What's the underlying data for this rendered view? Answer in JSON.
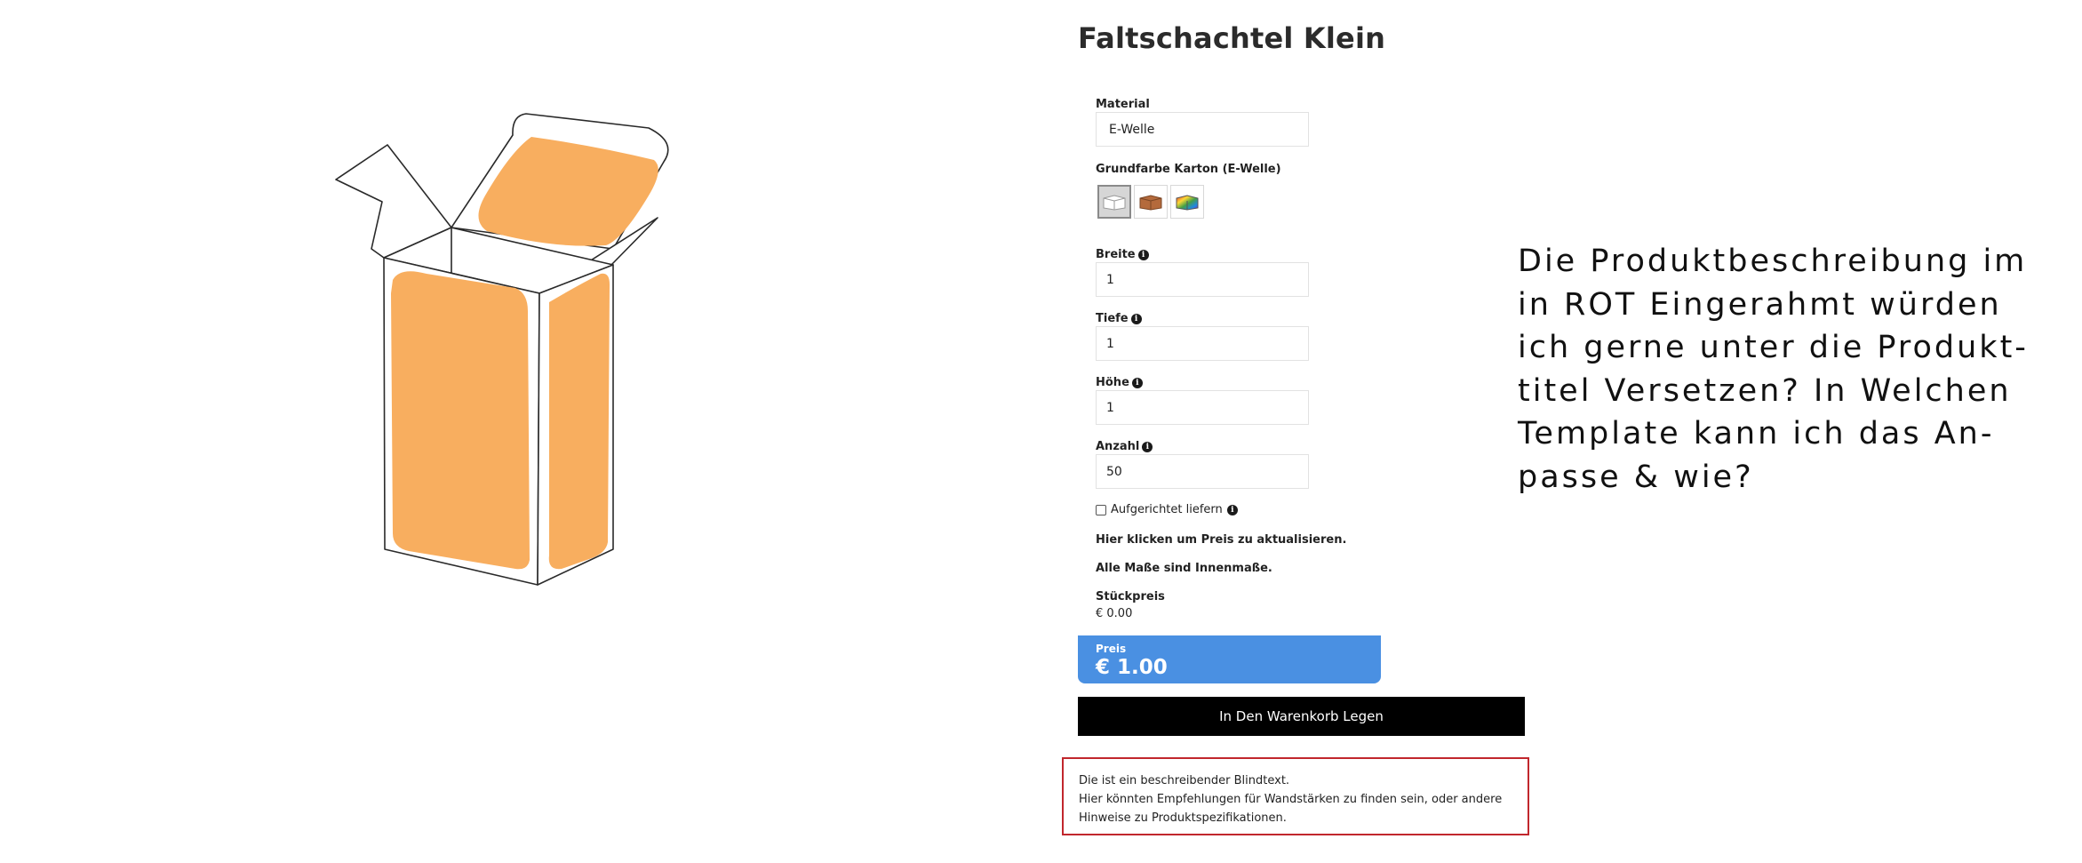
{
  "product": {
    "title": "Faltschachtel Klein",
    "image_icon": "box-illustration",
    "accent_color": "#f8ae5f"
  },
  "form": {
    "material": {
      "label": "Material",
      "value": "E-Welle"
    },
    "color": {
      "label": "Grundfarbe Karton (E-Welle)",
      "swatches": [
        "white-box-icon",
        "brown-box-icon",
        "rainbow-box-icon"
      ],
      "selected_index": 0
    },
    "breite": {
      "label": "Breite",
      "value": "1"
    },
    "tiefe": {
      "label": "Tiefe",
      "value": "1"
    },
    "hoehe": {
      "label": "Höhe",
      "value": "1"
    },
    "anzahl": {
      "label": "Anzahl",
      "value": "50"
    },
    "aufgerichtet": {
      "label": "Aufgerichtet liefern",
      "checked": false
    },
    "info_icon": "info-icon"
  },
  "notes": {
    "update_price": "Hier klicken um Preis zu aktualisieren.",
    "inner_dimensions": "Alle Maße sind Innenmaße."
  },
  "pricing": {
    "unit_label": "Stückpreis",
    "unit_value": "€ 0.00",
    "price_label": "Preis",
    "price_value": "€ 1.00",
    "price_box_color": "#4a90e2"
  },
  "cart_button": "In Den Warenkorb Legen",
  "description": {
    "lines": [
      "Die ist ein beschreibender Blindtext.",
      "Hier könnten Empfehlungen für Wandstärken zu finden sein, oder andere",
      "Hinweise zu Produktspezifikationen."
    ],
    "border_color": "#c1272d"
  },
  "annotation": {
    "lines": [
      "Die Produktbeschreibung im",
      "in ROT Eingerahmt würden",
      "ich gerne unter die Produkt-",
      "titel Versetzen? In Welchen",
      "Template kann ich das An-",
      "passe & wie?"
    ]
  }
}
